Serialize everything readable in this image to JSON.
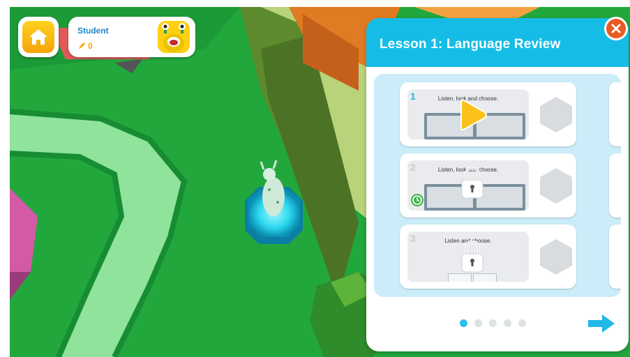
{
  "hud": {
    "home_icon": "home-icon",
    "student_name": "Student",
    "points": "0",
    "points_icon": "pencil-icon"
  },
  "lesson_panel": {
    "title": "Lesson 1: Language Review",
    "close_icon": "close-icon",
    "activities": [
      {
        "number": "1",
        "instruction": "Listen, look and choose.",
        "state": "available",
        "icon": "play-icon",
        "number_color": "#1fb8e6"
      },
      {
        "number": "2",
        "instruction": "Listen, look and choose.",
        "state": "locked",
        "icon": "lock-icon",
        "timer_icon": "clock-icon",
        "number_color": "#c7cbcf"
      },
      {
        "number": "3",
        "instruction": "Listen and choose.",
        "state": "locked",
        "icon": "lock-icon",
        "number_color": "#c7cbcf"
      }
    ],
    "pagination": {
      "pages": 5,
      "current": 1
    },
    "next_icon": "arrow-right-icon"
  },
  "colors": {
    "accent": "#15bde6",
    "grass": "#1fa13a",
    "path": "#7fd98f",
    "home": "#ffc815",
    "close": "#ea5a24",
    "play": "#fbc21b"
  }
}
